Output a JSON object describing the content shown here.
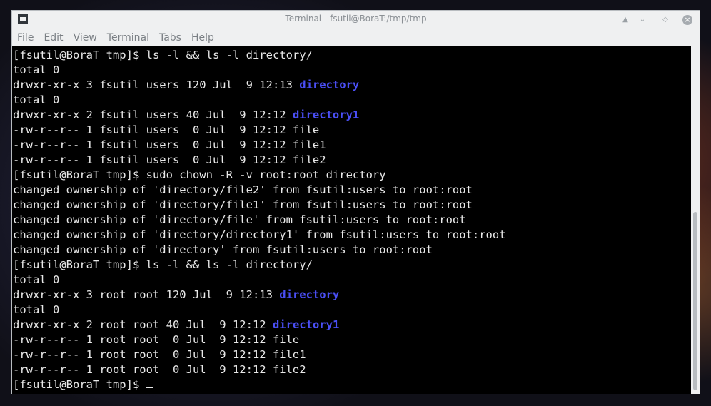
{
  "window": {
    "title": "Terminal - fsutil@BoraT:/tmp/tmp",
    "controls": {
      "minimize": "▲",
      "maximize": "◇",
      "close": "×"
    }
  },
  "menu": [
    "File",
    "Edit",
    "View",
    "Terminal",
    "Tabs",
    "Help"
  ],
  "terminal": {
    "lines": [
      [
        {
          "t": "[fsutil@BoraT tmp]$ ls -l && ls -l directory/"
        }
      ],
      [
        {
          "t": "total 0"
        }
      ],
      [
        {
          "t": "drwxr-xr-x 3 fsutil users 120 Jul  9 12:13 "
        },
        {
          "t": "directory",
          "dir": true
        }
      ],
      [
        {
          "t": "total 0"
        }
      ],
      [
        {
          "t": "drwxr-xr-x 2 fsutil users 40 Jul  9 12:12 "
        },
        {
          "t": "directory1",
          "dir": true
        }
      ],
      [
        {
          "t": "-rw-r--r-- 1 fsutil users  0 Jul  9 12:12 file"
        }
      ],
      [
        {
          "t": "-rw-r--r-- 1 fsutil users  0 Jul  9 12:12 file1"
        }
      ],
      [
        {
          "t": "-rw-r--r-- 1 fsutil users  0 Jul  9 12:12 file2"
        }
      ],
      [
        {
          "t": "[fsutil@BoraT tmp]$ sudo chown -R -v root:root directory"
        }
      ],
      [
        {
          "t": "changed ownership of 'directory/file2' from fsutil:users to root:root"
        }
      ],
      [
        {
          "t": "changed ownership of 'directory/file1' from fsutil:users to root:root"
        }
      ],
      [
        {
          "t": "changed ownership of 'directory/file' from fsutil:users to root:root"
        }
      ],
      [
        {
          "t": "changed ownership of 'directory/directory1' from fsutil:users to root:root"
        }
      ],
      [
        {
          "t": "changed ownership of 'directory' from fsutil:users to root:root"
        }
      ],
      [
        {
          "t": "[fsutil@BoraT tmp]$ ls -l && ls -l directory/"
        }
      ],
      [
        {
          "t": "total 0"
        }
      ],
      [
        {
          "t": "drwxr-xr-x 3 root root 120 Jul  9 12:13 "
        },
        {
          "t": "directory",
          "dir": true
        }
      ],
      [
        {
          "t": "total 0"
        }
      ],
      [
        {
          "t": "drwxr-xr-x 2 root root 40 Jul  9 12:12 "
        },
        {
          "t": "directory1",
          "dir": true
        }
      ],
      [
        {
          "t": "-rw-r--r-- 1 root root  0 Jul  9 12:12 file"
        }
      ],
      [
        {
          "t": "-rw-r--r-- 1 root root  0 Jul  9 12:12 file1"
        }
      ],
      [
        {
          "t": "-rw-r--r-- 1 root root  0 Jul  9 12:12 file2"
        }
      ],
      [
        {
          "t": "[fsutil@BoraT tmp]$ "
        },
        {
          "cursor": true
        }
      ]
    ]
  },
  "colors": {
    "directory": "#4a4ff5",
    "text": "#e9e9e9",
    "background": "#000000"
  }
}
